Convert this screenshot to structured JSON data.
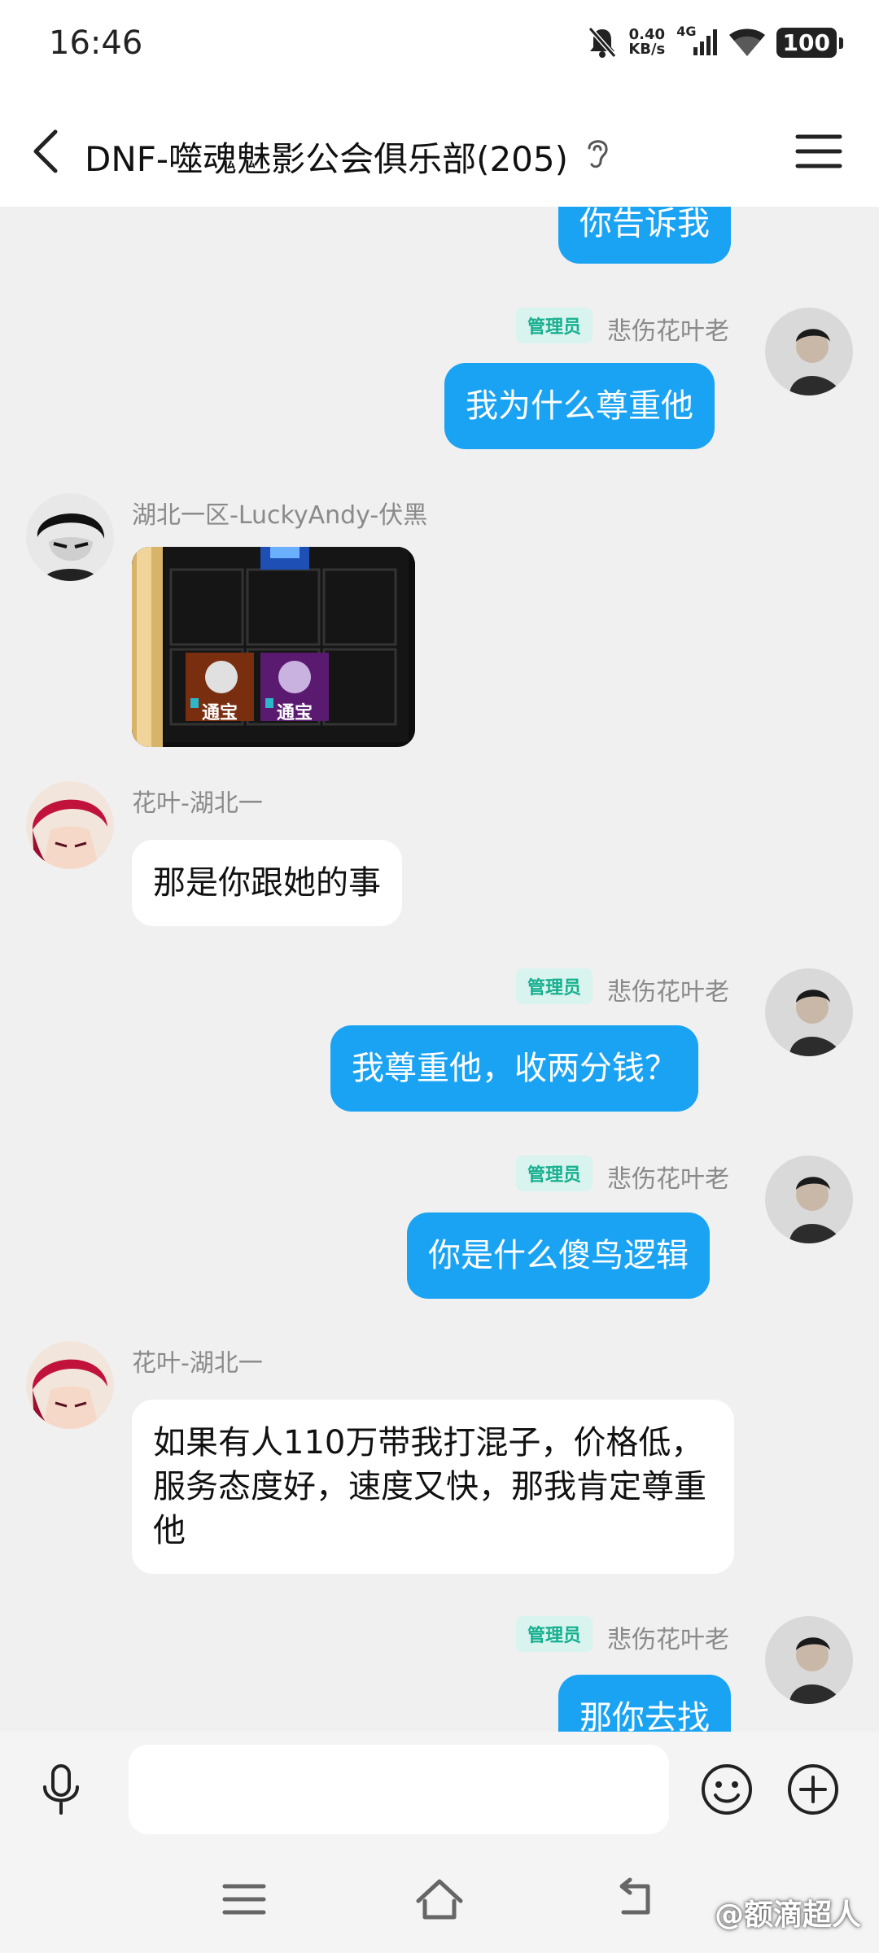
{
  "status_bar": {
    "time": "16:46",
    "net_speed_value": "0.40",
    "net_speed_unit": "KB/s",
    "signal_label": "4G",
    "battery": "100",
    "icons": [
      "mute-bell-icon",
      "signal-bars-icon",
      "wifi-icon",
      "battery-icon"
    ]
  },
  "header": {
    "title": "DNF-噬魂魅影公会俱乐部(205)",
    "icons": [
      "back-arrow-icon",
      "ear-icon",
      "menu-icon"
    ]
  },
  "messages": [
    {
      "side": "right",
      "text": "你告诉我",
      "partial": true
    },
    {
      "side": "right",
      "badge": "管理员",
      "sender": "悲伤花叶老",
      "text": "我为什么尊重他"
    },
    {
      "side": "left",
      "sender": "湖北一区-LuckyAndy-伏黑",
      "type": "image",
      "image_tags": [
        "通宝",
        "通宝"
      ]
    },
    {
      "side": "left",
      "sender": "花叶-湖北一",
      "text": "那是你跟她的事"
    },
    {
      "side": "right",
      "badge": "管理员",
      "sender": "悲伤花叶老",
      "text": "我尊重他，收两分钱？"
    },
    {
      "side": "right",
      "badge": "管理员",
      "sender": "悲伤花叶老",
      "text": "你是什么傻鸟逻辑"
    },
    {
      "side": "left",
      "sender": "花叶-湖北一",
      "text": "如果有人110万带我打混子，价格低，服务态度好，速度又快，那我肯定尊重他"
    },
    {
      "side": "right",
      "badge": "管理员",
      "sender": "悲伤花叶老",
      "text": "那你去找",
      "partial": true
    }
  ],
  "input_bar": {
    "placeholder": "",
    "icons": [
      "microphone-icon",
      "emoji-icon",
      "plus-circle-icon"
    ]
  },
  "nav_bar": {
    "icons": [
      "nav-menu-icon",
      "nav-home-icon",
      "nav-back-icon"
    ]
  },
  "watermark": "@额滴超人",
  "colors": {
    "my_bubble": "#1ba3f3",
    "other_bubble": "#ffffff",
    "admin_badge_bg": "#d9f3ee",
    "admin_badge_text": "#15b08f",
    "chat_background": "#f0f0f0"
  }
}
